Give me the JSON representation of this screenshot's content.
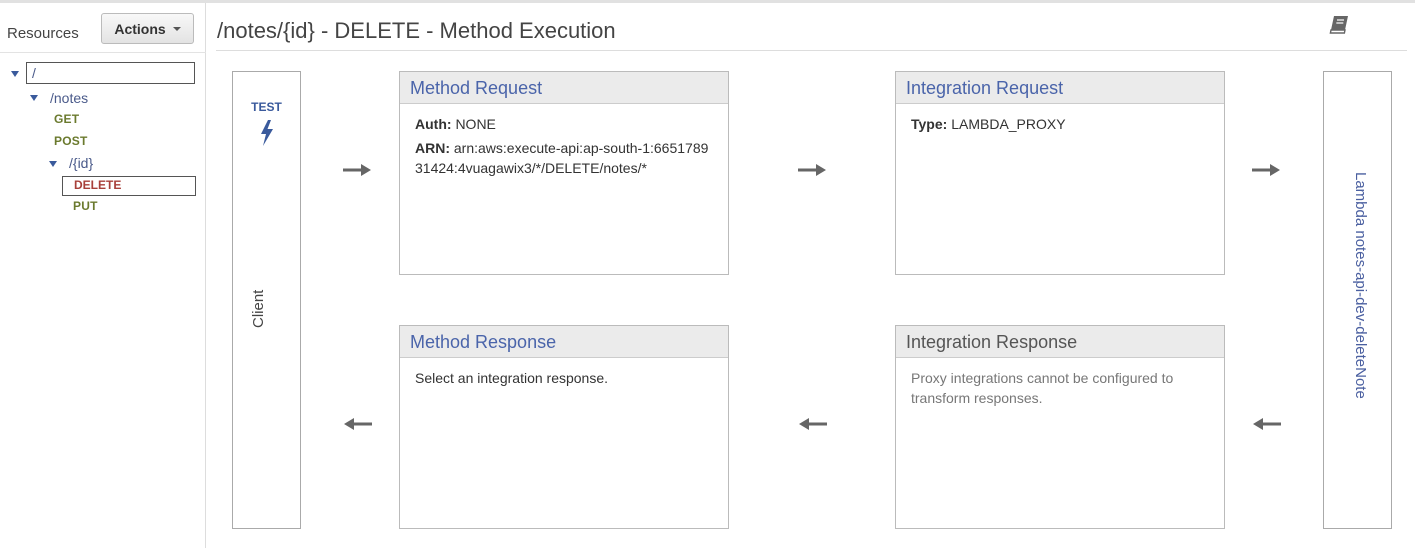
{
  "sidebar": {
    "title": "Resources",
    "actions_label": "Actions",
    "tree": {
      "root": "/",
      "notes": "/notes",
      "notes_get": "GET",
      "notes_post": "POST",
      "id": "/{id}",
      "id_delete": "DELETE",
      "id_put": "PUT"
    }
  },
  "main": {
    "title": "/notes/{id} - DELETE - Method Execution",
    "client": {
      "test_label": "TEST",
      "label": "Client"
    },
    "lambda_label": "Lambda notes-api-dev-deleteNote",
    "method_request": {
      "title": "Method Request",
      "auth_key": "Auth:",
      "auth_value": "NONE",
      "arn_key": "ARN:",
      "arn_value": "arn:aws:execute-api:ap-south-1:665178931424:4vuagawix3/*/DELETE/notes/*"
    },
    "integration_request": {
      "title": "Integration Request",
      "type_key": "Type:",
      "type_value": "LAMBDA_PROXY"
    },
    "method_response": {
      "title": "Method Response",
      "body": "Select an integration response."
    },
    "integration_response": {
      "title": "Integration Response",
      "body": "Proxy integrations cannot be configured to transform responses."
    }
  },
  "colors": {
    "link": "#4a64aa",
    "method_green": "#6b7a2e",
    "method_red": "#a8403a"
  },
  "icons": {
    "docs": "book-icon",
    "test": "lightning-bolt-icon"
  }
}
